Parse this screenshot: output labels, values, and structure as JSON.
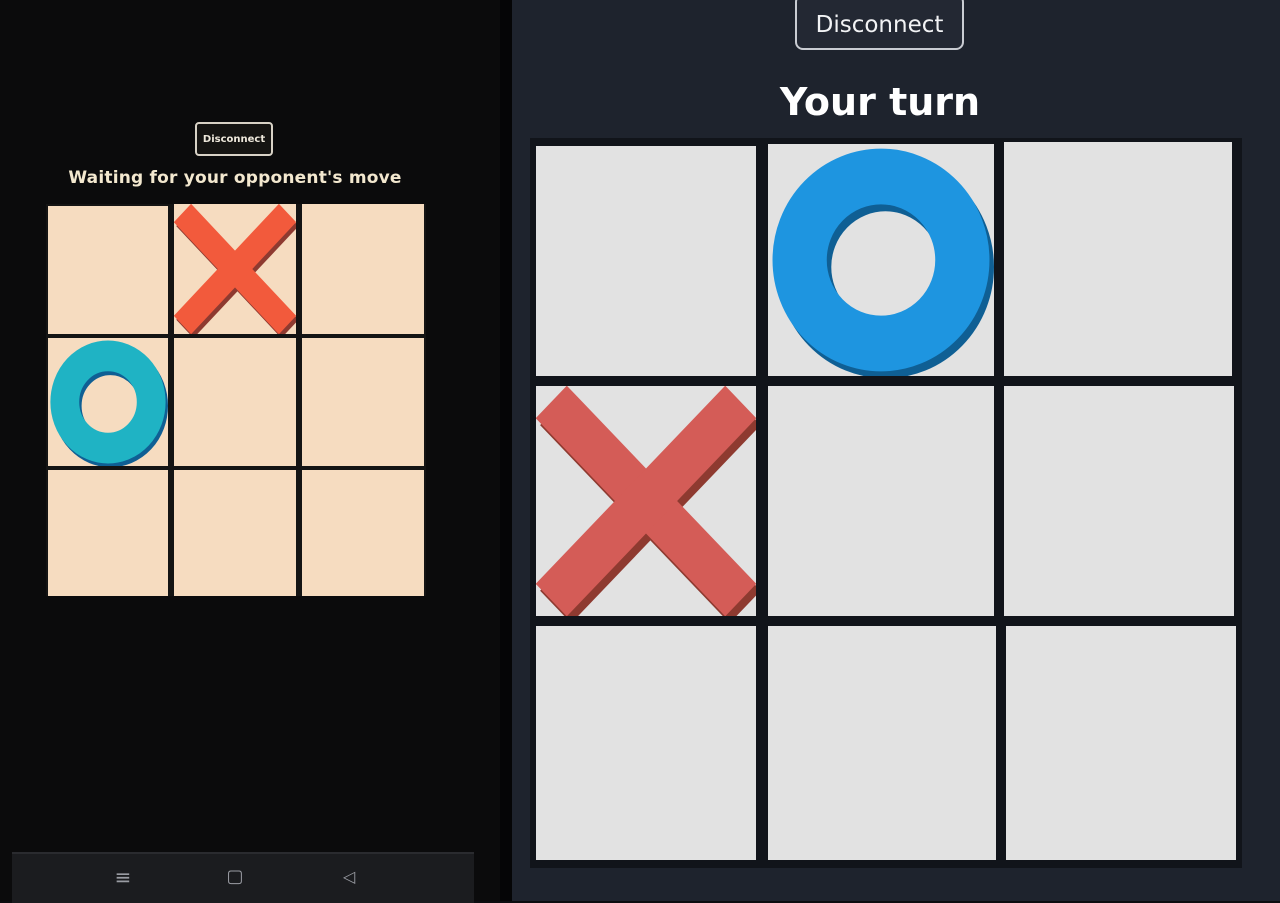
{
  "left_device": {
    "disconnect_label": "Disconnect",
    "status_text": "Waiting for your opponent's move",
    "board": [
      "",
      "X",
      "",
      "O",
      "",
      "",
      "",
      "",
      ""
    ],
    "colors": {
      "cell": "#f6dcc0",
      "x": "#f25a3c",
      "o": "#1fb3c4"
    },
    "nav": {
      "menu_icon": "≡",
      "home_icon": "▢",
      "back_icon": "◁"
    }
  },
  "right_device": {
    "disconnect_label": "Disconnect",
    "status_text": "Your turn",
    "board": [
      "",
      "O",
      "",
      "X",
      "",
      "",
      "",
      "",
      ""
    ],
    "colors": {
      "cell": "#e2e2e2",
      "x": "#d45c57",
      "o": "#1e95e0"
    }
  }
}
